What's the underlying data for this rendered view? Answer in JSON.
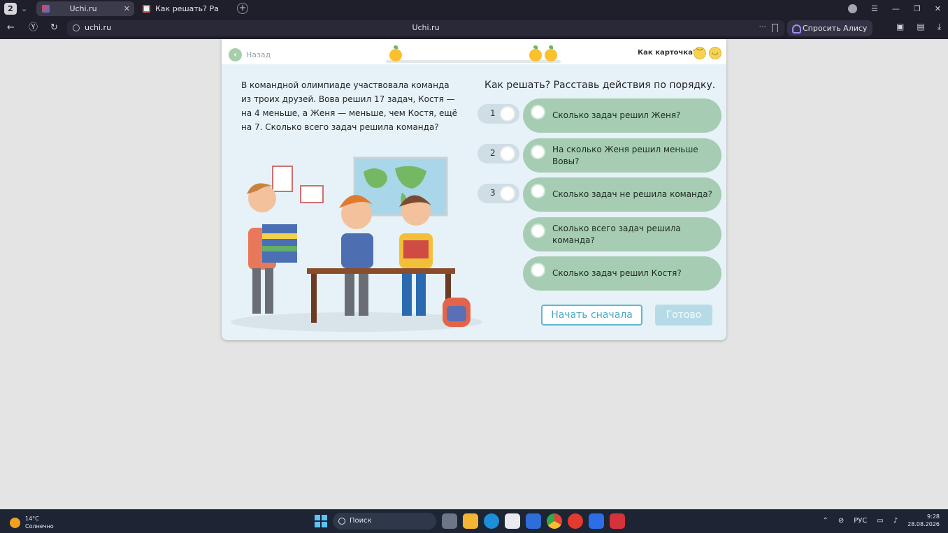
{
  "browser": {
    "tab_count": "2",
    "tabs": [
      {
        "title": "Uchi.ru",
        "close": "✕"
      },
      {
        "title": "Как решать? Расставь де",
        "close": ""
      }
    ],
    "host": "uchi.ru",
    "page_title": "Uchi.ru",
    "alice_label": "Спросить Алису AI"
  },
  "card": {
    "back_label": "Назад",
    "rate_label": "Как карточка?",
    "progress_fraction": 0.0,
    "problem_text": "В командной олимпиаде участвовала команда из троих друзей. Вова решил 17 задач, Костя — на 4 меньше, а Женя — меньше, чем Костя, ещё на 7. Сколько всего задач решила команда?",
    "question_title": "Как решать? Расставь действия по порядку.",
    "slots": [
      {
        "number": "1"
      },
      {
        "number": "2"
      },
      {
        "number": "3"
      }
    ],
    "options": [
      {
        "label": "Сколько задач решил Женя?"
      },
      {
        "label": "На сколько Женя решил меньше Вовы?"
      },
      {
        "label": "Сколько задач не решила команда?"
      },
      {
        "label": "Сколько всего задач решила команда?"
      },
      {
        "label": "Сколько задач решил Костя?"
      }
    ],
    "restart_label": "Начать сначала",
    "done_label": "Готово"
  },
  "taskbar": {
    "temperature": "14°C",
    "weather": "Солнечно",
    "search_label": "Поиск",
    "language": "РУС",
    "time": "9:28",
    "date": "28.08.2026"
  },
  "colors": {
    "accent_green": "#a6cdb3",
    "accent_blue": "#5fb7cf",
    "orange_fruit": "#fbc02d"
  }
}
